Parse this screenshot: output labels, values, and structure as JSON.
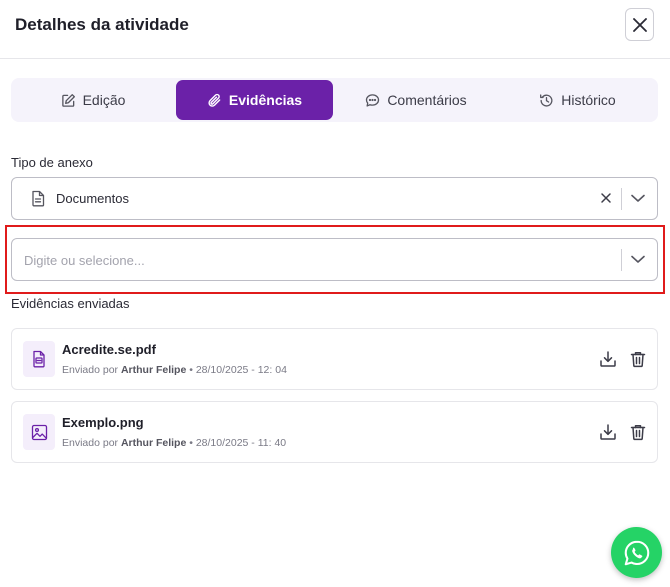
{
  "dialog": {
    "title": "Detalhes da atividade",
    "close_icon": "close-icon"
  },
  "tabs": [
    {
      "label": "Edição",
      "icon": "edit-icon",
      "active": false
    },
    {
      "label": "Evidências",
      "icon": "paperclip-icon",
      "active": true
    },
    {
      "label": "Comentários",
      "icon": "comment-icon",
      "active": false
    },
    {
      "label": "Histórico",
      "icon": "history-icon",
      "active": false
    }
  ],
  "attachment_type": {
    "label": "Tipo de anexo",
    "selected_value": "Documentos",
    "icon": "document-icon"
  },
  "document_select": {
    "placeholder": "Digite ou selecione...",
    "value": ""
  },
  "evidences": {
    "title": "Evidências enviadas",
    "sent_by_prefix": "Enviado por",
    "items": [
      {
        "name": "Acredite.se.pdf",
        "author": "Arthur Felipe",
        "datetime": "• 28/10/2025 - 12: 04",
        "icon": "pdf-file-icon"
      },
      {
        "name": "Exemplo.png",
        "author": "Arthur Felipe",
        "datetime": "• 28/10/2025 - 11: 40",
        "icon": "image-file-icon"
      }
    ]
  },
  "colors": {
    "accent": "#6b21a8",
    "tab_bar_bg": "#f5f3fb",
    "highlight_border": "#e01b1b",
    "whatsapp": "#25d366"
  }
}
